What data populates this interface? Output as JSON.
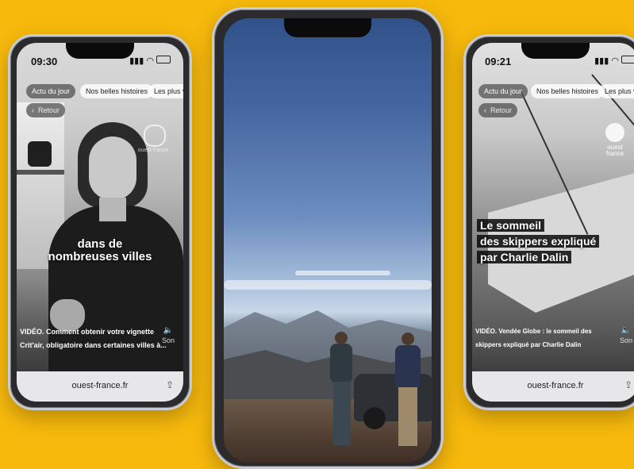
{
  "background_color": "#F7B90C",
  "left_phone": {
    "time": "09:30",
    "tabs": [
      "Actu du jour",
      "Nos belles histoires",
      "Les plus vus"
    ],
    "back_label": "Retour",
    "caption": "dans de nombreuses villes",
    "video_title_line1": "VIDÉO. Comment obtenir votre vignette",
    "video_title_line2": "Crit'air, obligatoire dans certaines villes à...",
    "sound_label": "Son",
    "url": "ouest-france.fr",
    "logo_text": "ouest france"
  },
  "right_phone": {
    "time": "09:21",
    "tabs": [
      "Actu du jour",
      "Nos belles histoires",
      "Les plus vus"
    ],
    "back_label": "Retour",
    "headline": [
      "Le sommeil",
      "des skippers expliqué",
      "par Charlie Dalin"
    ],
    "video_title_line1": "VIDÉO. Vendée Globe : le sommeil des",
    "video_title_line2": "skippers expliqué par Charlie Dalin",
    "sound_label": "Son",
    "url": "ouest-france.fr",
    "logo_text": "ouest france"
  }
}
